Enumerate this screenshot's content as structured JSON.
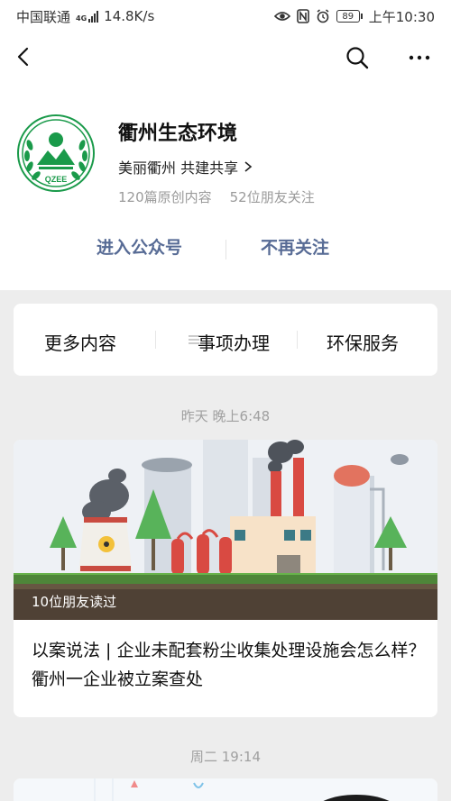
{
  "status_bar": {
    "carrier": "中国联通",
    "network_type": "4G",
    "speed": "14.8K/s",
    "battery": "89",
    "time": "上午10:30"
  },
  "account": {
    "name": "衢州生态环境",
    "slogan": "美丽衢州 共建共享",
    "original_count": "120篇原创内容",
    "friends_follow": "52位朋友关注",
    "logo_text": "QZEE"
  },
  "actions": {
    "enter": "进入公众号",
    "unfollow": "不再关注"
  },
  "menu": {
    "items": [
      "更多内容",
      "事项办理",
      "环保服务"
    ]
  },
  "articles": [
    {
      "time": "昨天 晚上6:48",
      "read_by": "10位朋友读过",
      "title": "以案说法 | 企业未配套粉尘收集处理设施会怎么样？衢州一企业被立案查处"
    },
    {
      "time": "周二 19:14"
    }
  ],
  "colors": {
    "link": "#576b95",
    "logo_green": "#1a9a4a",
    "background": "#ededed"
  }
}
